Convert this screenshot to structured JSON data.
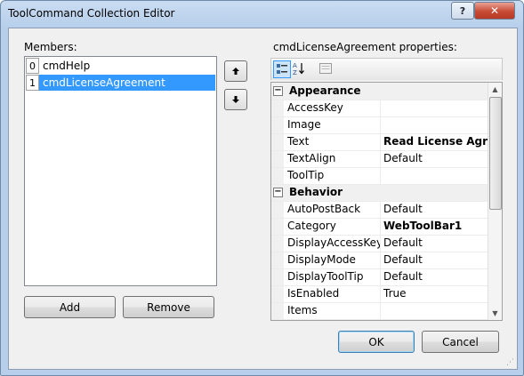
{
  "window": {
    "title": "ToolCommand Collection Editor",
    "help_label": "?",
    "close_label": "✕"
  },
  "members": {
    "label": "Members:",
    "items": [
      {
        "index": "0",
        "name": "cmdHelp"
      },
      {
        "index": "1",
        "name": "cmdLicenseAgreement",
        "selected": true
      }
    ],
    "up_label": "🡅",
    "down_label": "🡇"
  },
  "buttons": {
    "add": "Add",
    "remove": "Remove",
    "ok": "OK",
    "cancel": "Cancel"
  },
  "properties": {
    "label": "cmdLicenseAgreement properties:",
    "toolbar_icons": [
      "categorized-icon",
      "alphabetical-icon",
      "property-pages-icon"
    ],
    "rows": [
      {
        "type": "category",
        "name": "Appearance",
        "expander": "−"
      },
      {
        "type": "prop",
        "name": "AccessKey",
        "value": ""
      },
      {
        "type": "prop",
        "name": "Image",
        "value": ""
      },
      {
        "type": "prop",
        "name": "Text",
        "value": "Read License Agreem",
        "bold": true
      },
      {
        "type": "prop",
        "name": "TextAlign",
        "value": "Default"
      },
      {
        "type": "prop",
        "name": "ToolTip",
        "value": ""
      },
      {
        "type": "category",
        "name": "Behavior",
        "expander": "−"
      },
      {
        "type": "prop",
        "name": "AutoPostBack",
        "value": "Default"
      },
      {
        "type": "prop",
        "name": "Category",
        "value": "WebToolBar1",
        "bold": true
      },
      {
        "type": "prop",
        "name": "DisplayAccessKeyO",
        "value": "Default"
      },
      {
        "type": "prop",
        "name": "DisplayMode",
        "value": "Default"
      },
      {
        "type": "prop",
        "name": "DisplayToolTip",
        "value": "Default"
      },
      {
        "type": "prop",
        "name": "IsEnabled",
        "value": "True"
      },
      {
        "type": "prop",
        "name": "Items",
        "value": ""
      }
    ]
  },
  "colors": {
    "selection": "#3399ff",
    "title_bg": "#b7cfeb",
    "close": "#c74a35"
  }
}
